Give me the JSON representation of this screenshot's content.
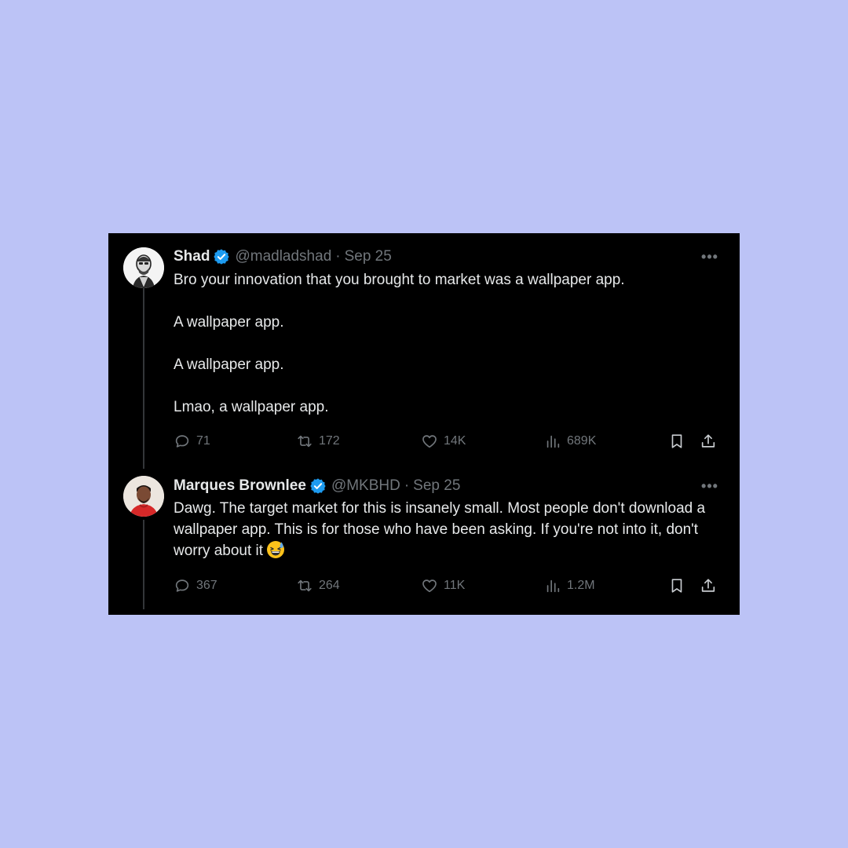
{
  "colors": {
    "background": "#bcc3f6",
    "card": "#000000",
    "text": "#e7e9ea",
    "muted": "#71767b",
    "verified": "#1d9bf0"
  },
  "tweets": [
    {
      "name": "Shad",
      "handle": "@madladshad",
      "separator": "·",
      "date": "Sep 25",
      "verified": true,
      "text_lines": [
        "Bro your innovation that you brought to market was a wallpaper app.",
        "A wallpaper app.",
        "A wallpaper app.",
        "Lmao, a wallpaper app."
      ],
      "replies": "71",
      "retweets": "172",
      "likes": "14K",
      "views": "689K"
    },
    {
      "name": "Marques Brownlee",
      "handle": "@MKBHD",
      "separator": "·",
      "date": "Sep 25",
      "verified": true,
      "text": "Dawg. The target market for this is insanely small. Most people don't download a wallpaper app. This is for those who have been asking. If you're not into it, don't worry about it",
      "emoji": "grinning-sweat-emoji",
      "replies": "367",
      "retweets": "264",
      "likes": "11K",
      "views": "1.2M"
    }
  ]
}
